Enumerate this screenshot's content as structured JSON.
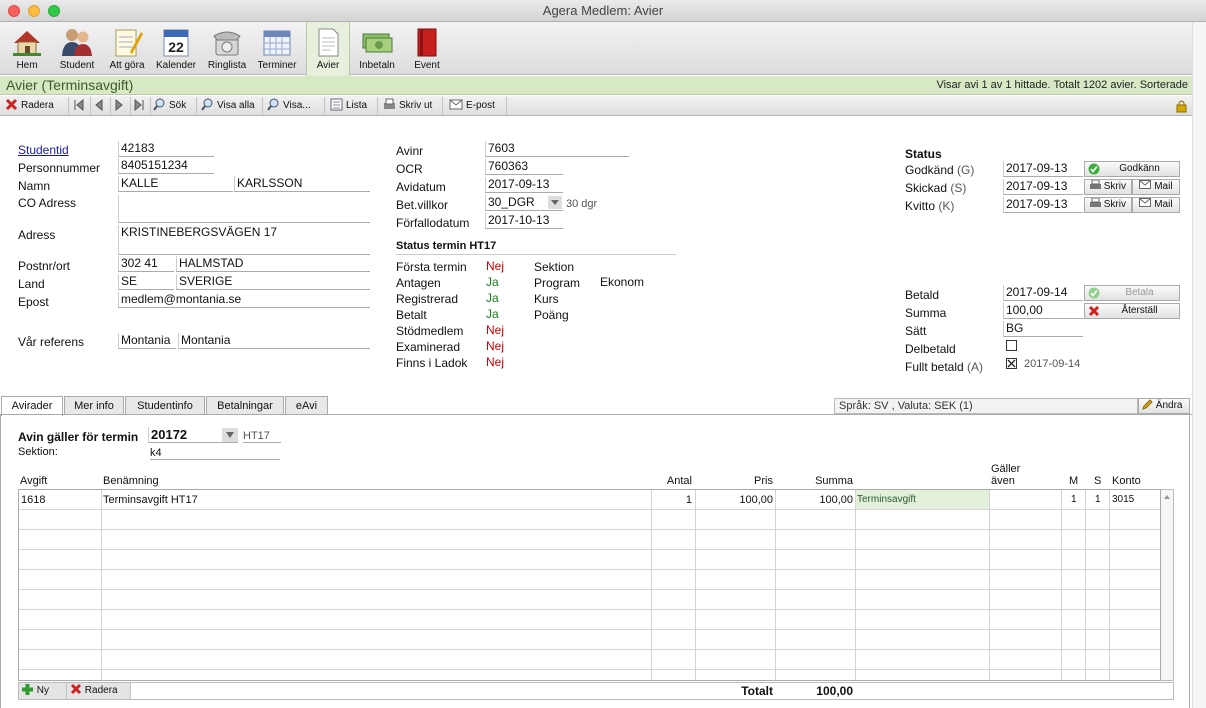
{
  "window": {
    "title": "Agera Medlem: Avier"
  },
  "toolbar": [
    {
      "label": "Hem",
      "icon": "house-icon"
    },
    {
      "label": "Student",
      "icon": "people-icon"
    },
    {
      "label": "Att göra",
      "icon": "notepad-icon"
    },
    {
      "label": "Kalender",
      "icon": "calendar-icon",
      "day": "22"
    },
    {
      "label": "Ringlista",
      "icon": "phone-icon"
    },
    {
      "label": "Terminer",
      "icon": "grid-calendar-icon"
    },
    {
      "label": "Avier",
      "icon": "document-icon"
    },
    {
      "label": "Inbetaln",
      "icon": "money-icon"
    },
    {
      "label": "Event",
      "icon": "book-icon"
    }
  ],
  "header": {
    "title": "Avier (Terminsavgift)",
    "status": "Visar avi 1 av 1 hittade. Totalt 1202 avier. Sorterade"
  },
  "actions": {
    "delete": "Radera",
    "search": "Sök",
    "show_all": "Visa alla",
    "show": "Visa...",
    "list": "Lista",
    "print": "Skriv ut",
    "email": "E-post"
  },
  "student": {
    "studentid_label": "Studentid",
    "studentid": "42183",
    "pnr_label": "Personnummer",
    "pnr": "8405151234",
    "name_label": "Namn",
    "first": "KALLE",
    "last": "KARLSSON",
    "co_label": "CO Adress",
    "co": "",
    "addr_label": "Adress",
    "addr": "KRISTINEBERGSVÄGEN 17",
    "postal_label": "Postnr/ort",
    "zip": "302 41",
    "city": "HALMSTAD",
    "country_label": "Land",
    "country_code": "SE",
    "country": "SVERIGE",
    "email_label": "Epost",
    "email": "medlem@montania.se",
    "ref_label": "Vår referens",
    "ref1": "Montania",
    "ref2": "Montania"
  },
  "invoice": {
    "avinr_label": "Avinr",
    "avinr": "7603",
    "ocr_label": "OCR",
    "ocr": "760363",
    "date_label": "Avidatum",
    "date": "2017-09-13",
    "terms_label": "Bet.villkor",
    "terms": "30_DGR",
    "terms_text": "30 dgr",
    "due_label": "Förfallodatum",
    "due": "2017-10-13"
  },
  "term_status": {
    "title": "Status termin HT17",
    "rows": [
      {
        "label": "Första termin",
        "value": "Nej",
        "ok": false
      },
      {
        "label": "Antagen",
        "value": "Ja",
        "ok": true
      },
      {
        "label": "Registrerad",
        "value": "Ja",
        "ok": true
      },
      {
        "label": "Betalt",
        "value": "Ja",
        "ok": true
      },
      {
        "label": "Stödmedlem",
        "value": "Nej",
        "ok": false
      },
      {
        "label": "Examinerad",
        "value": "Nej",
        "ok": false
      },
      {
        "label": "Finns i Ladok",
        "value": "Nej",
        "ok": false
      }
    ],
    "section_label": "Sektion",
    "program_label": "Program",
    "program": "Ekonom",
    "course_label": "Kurs",
    "points_label": "Poäng"
  },
  "status": {
    "title": "Status",
    "approved_label": "Godkänd",
    "approved_key": "(G)",
    "approved_date": "2017-09-13",
    "approve_btn": "Godkänn",
    "sent_label": "Skickad",
    "sent_key": "(S)",
    "sent_date": "2017-09-13",
    "receipt_label": "Kvitto",
    "receipt_key": "(K)",
    "receipt_date": "2017-09-13",
    "print_btn": "Skriv",
    "mail_btn": "Mail",
    "paid_label": "Betald",
    "paid_date": "2017-09-14",
    "pay_btn": "Betala",
    "sum_label": "Summa",
    "sum": "100,00",
    "reset_btn": "Återställ",
    "method_label": "Sätt",
    "method": "BG",
    "partial_label": "Delbetald",
    "full_label": "Fullt betald",
    "full_key": "(A)",
    "full_date": "2017-09-14"
  },
  "tabs": [
    "Avirader",
    "Mer info",
    "Studentinfo",
    "Betalningar",
    "eAvi"
  ],
  "lang_info": "Språk: SV , Valuta: SEK (1)",
  "edit_btn": "Ändra",
  "term": {
    "label": "Avin gäller för termin",
    "value": "20172",
    "name": "HT17",
    "section_label": "Sektion:",
    "section": "k4"
  },
  "grid": {
    "headers": {
      "fee": "Avgift",
      "desc": "Benämning",
      "qty": "Antal",
      "price": "Pris",
      "sum": "Summa",
      "also1": "Gäller",
      "also2": "även",
      "m": "M",
      "s": "S",
      "account": "Konto"
    },
    "rows": [
      {
        "fee": "1618",
        "desc": "Terminsavgift HT17",
        "qty": "1",
        "price": "100,00",
        "sum": "100,00",
        "type": "Terminsavgift",
        "m": "1",
        "s": "1",
        "account": "3015"
      }
    ],
    "new_btn": "Ny",
    "delete_btn": "Radera",
    "total_label": "Totalt",
    "total": "100,00"
  },
  "colors": {
    "header_bg": "#d7e8c4",
    "red": "#cc0000",
    "green": "#1e7a1e",
    "link": "#1a1aa6"
  }
}
